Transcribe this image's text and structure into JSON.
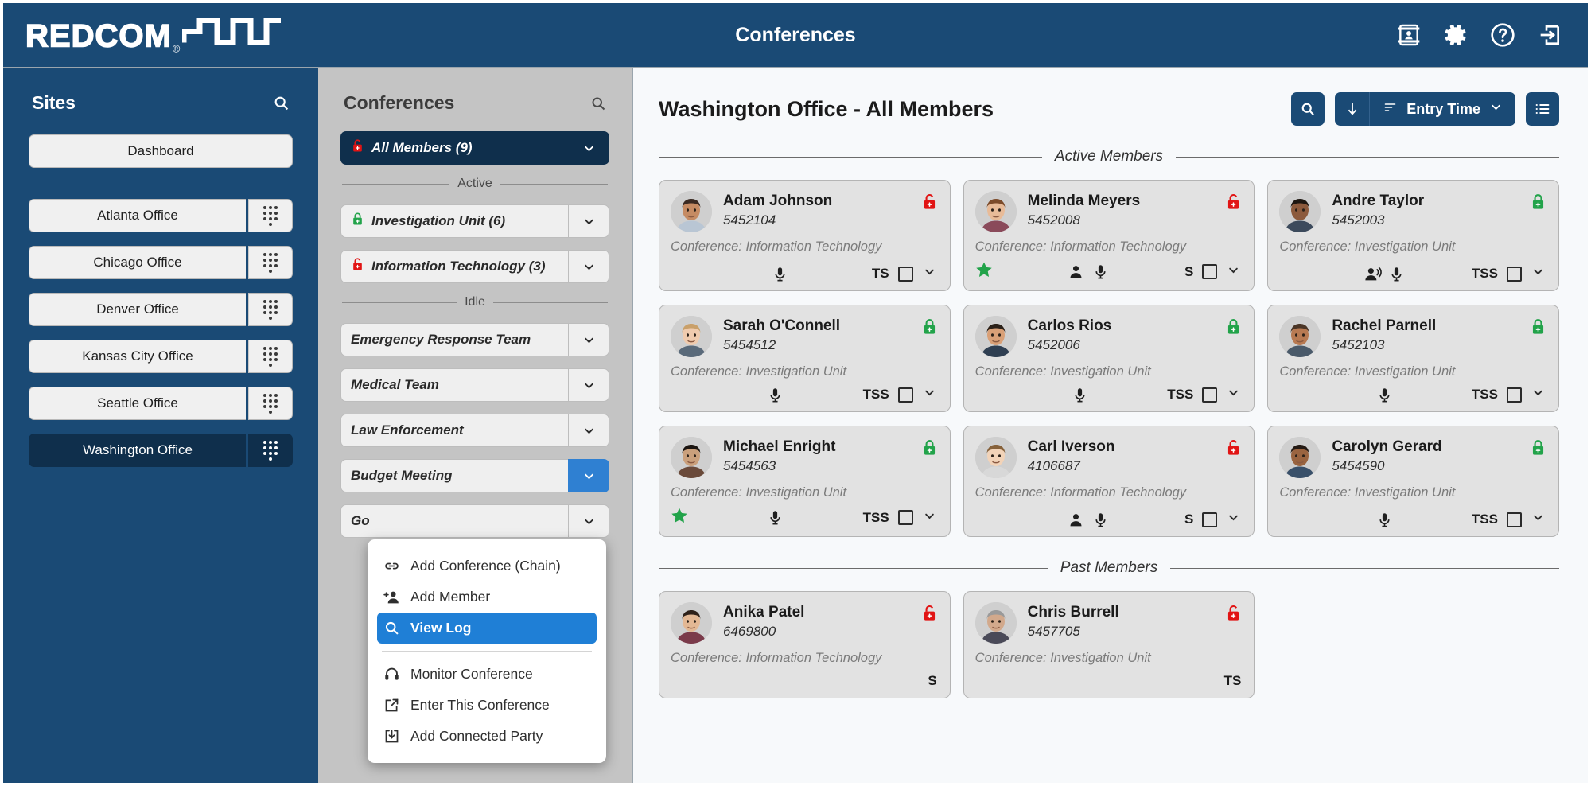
{
  "topbar": {
    "brand": "REDCOM",
    "brand_reg": "®",
    "title": "Conferences",
    "icons": [
      {
        "name": "contact-card-icon",
        "label": "Contacts"
      },
      {
        "name": "gear-icon",
        "label": "Settings"
      },
      {
        "name": "help-icon",
        "label": "Help"
      },
      {
        "name": "logout-icon",
        "label": "Log Out"
      }
    ]
  },
  "sidebar": {
    "title": "Sites",
    "search_icon": "search-icon",
    "dashboard": "Dashboard",
    "sites": [
      {
        "label": "Atlanta Office",
        "selected": false,
        "dialpad": true
      },
      {
        "label": "Chicago Office",
        "selected": false,
        "dialpad": true
      },
      {
        "label": "Denver Office",
        "selected": false,
        "dialpad": true
      },
      {
        "label": "Kansas City Office",
        "selected": false,
        "dialpad": true
      },
      {
        "label": "Seattle Office",
        "selected": false,
        "dialpad": true
      },
      {
        "label": "Washington Office",
        "selected": true,
        "dialpad": true
      }
    ]
  },
  "conferences": {
    "title": "Conferences",
    "search_icon": "search-icon",
    "selected": {
      "label": "All Members (9)",
      "lock": "unlocked",
      "selected": true
    },
    "groups": [
      {
        "label": "Active",
        "items": [
          {
            "label": "Investigation Unit (6)",
            "lock": "locked"
          },
          {
            "label": "Information Technology (3)",
            "lock": "unlocked"
          }
        ]
      },
      {
        "label": "Idle",
        "items": [
          {
            "label": "Emergency Response Team",
            "lock": "none"
          },
          {
            "label": "Medical Team",
            "lock": "none"
          },
          {
            "label": "Law Enforcement",
            "lock": "none"
          },
          {
            "label": "Budget Meeting",
            "lock": "none",
            "menu_open": true
          },
          {
            "label": "Go",
            "lock": "none"
          }
        ]
      }
    ],
    "context_menu": [
      {
        "label": "Add Conference (Chain)",
        "icon": "chain-link-icon",
        "active": false
      },
      {
        "label": "Add Member",
        "icon": "add-person-icon",
        "active": false
      },
      {
        "label": "View Log",
        "icon": "search-icon",
        "active": true
      },
      {
        "label": "Monitor Conference",
        "icon": "headset-icon",
        "active": false,
        "after_sep": true
      },
      {
        "label": "Enter This Conference",
        "icon": "external-link-icon",
        "active": false
      },
      {
        "label": "Add Connected Party",
        "icon": "download-box-icon",
        "active": false
      }
    ]
  },
  "main": {
    "title": "Washington Office - All Members",
    "toolbar": {
      "search_icon": "search-icon",
      "sort_direction_icon": "arrow-down-icon",
      "sort_icon": "sort-icon",
      "sort_label": "Entry Time",
      "sort_caret_icon": "chevron-down-icon",
      "list_view_icon": "list-view-icon"
    },
    "sections": [
      {
        "label": "Active Members"
      },
      {
        "label": "Past Members"
      }
    ],
    "active_members": [
      {
        "name": "Adam Johnson",
        "ext": "5452104",
        "conference": "Conference: Information Technology",
        "lock": "unlocked",
        "star": false,
        "icons": [
          "mic-icon"
        ],
        "badge": "TS",
        "checkbox": true,
        "caret": true,
        "avatar": "avatar-1"
      },
      {
        "name": "Melinda Meyers",
        "ext": "5452008",
        "conference": "Conference: Information Technology",
        "lock": "unlocked",
        "star": true,
        "icons": [
          "person-icon",
          "mic-icon"
        ],
        "badge": "S",
        "checkbox": true,
        "caret": true,
        "avatar": "avatar-2"
      },
      {
        "name": "Andre Taylor",
        "ext": "5452003",
        "conference": "Conference: Investigation Unit",
        "lock": "locked",
        "star": false,
        "icons": [
          "person-speaking-icon",
          "mic-icon"
        ],
        "badge": "TSS",
        "checkbox": true,
        "caret": true,
        "avatar": "avatar-3"
      },
      {
        "name": "Sarah O'Connell",
        "ext": "5454512",
        "conference": "Conference: Investigation Unit",
        "lock": "locked",
        "star": false,
        "icons": [
          "mic-icon"
        ],
        "badge": "TSS",
        "checkbox": true,
        "caret": true,
        "avatar": "avatar-4"
      },
      {
        "name": "Carlos Rios",
        "ext": "5452006",
        "conference": "Conference: Investigation Unit",
        "lock": "locked",
        "star": false,
        "icons": [
          "mic-icon"
        ],
        "badge": "TSS",
        "checkbox": true,
        "caret": true,
        "avatar": "avatar-5"
      },
      {
        "name": "Rachel Parnell",
        "ext": "5452103",
        "conference": "Conference: Investigation Unit",
        "lock": "locked",
        "star": false,
        "icons": [
          "mic-icon"
        ],
        "badge": "TSS",
        "checkbox": true,
        "caret": true,
        "avatar": "avatar-6"
      },
      {
        "name": "Michael Enright",
        "ext": "5454563",
        "conference": "Conference: Investigation Unit",
        "lock": "locked",
        "star": true,
        "icons": [
          "mic-icon"
        ],
        "badge": "TSS",
        "checkbox": true,
        "caret": true,
        "avatar": "avatar-7"
      },
      {
        "name": "Carl Iverson",
        "ext": "4106687",
        "conference": "Conference: Information Technology",
        "lock": "unlocked",
        "star": false,
        "icons": [
          "person-icon",
          "mic-icon"
        ],
        "badge": "S",
        "checkbox": true,
        "caret": true,
        "avatar": "avatar-8"
      },
      {
        "name": "Carolyn Gerard",
        "ext": "5454590",
        "conference": "Conference: Investigation Unit",
        "lock": "locked",
        "star": false,
        "icons": [
          "mic-icon"
        ],
        "badge": "TSS",
        "checkbox": true,
        "caret": true,
        "avatar": "avatar-9"
      }
    ],
    "past_members": [
      {
        "name": "Anika Patel",
        "ext": "6469800",
        "conference": "Conference: Information Technology",
        "lock": "unlocked",
        "badge": "S",
        "avatar": "avatar-10"
      },
      {
        "name": "Chris Burrell",
        "ext": "5457705",
        "conference": "Conference: Investigation Unit",
        "lock": "unlocked",
        "badge": "TS",
        "avatar": "avatar-11"
      }
    ]
  },
  "colors": {
    "brand_blue": "#1a4a75",
    "dark_navy": "#0f2f4c",
    "accent_blue": "#1f7fd6",
    "lock_locked_green": "#22a34a",
    "lock_unlocked_red": "#e11414",
    "star_green": "#22a34a",
    "panel_gray": "#c4c4c4",
    "card_gray": "#e2e2e2"
  }
}
